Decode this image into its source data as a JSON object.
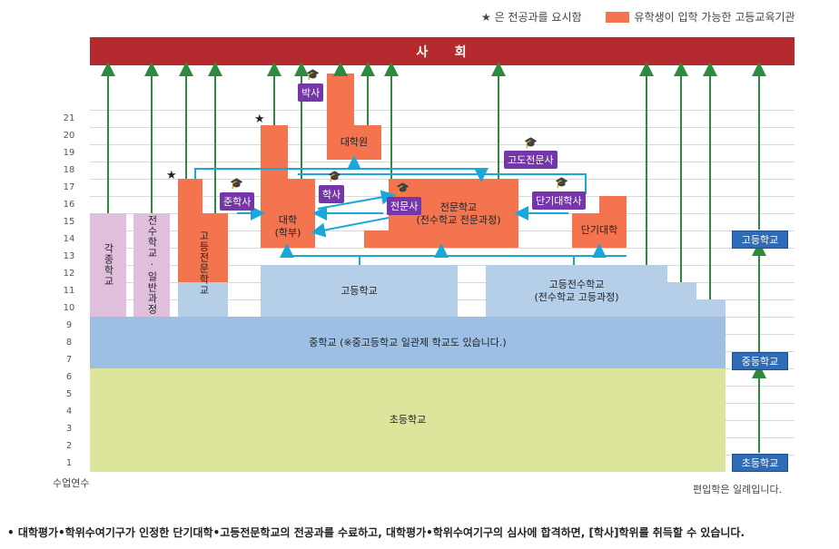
{
  "legend": {
    "star_text": "★ 은 전공과를 요시함",
    "box_text": "유학생이 입학 가능한 고등교육기관"
  },
  "header": {
    "title": "사    회"
  },
  "years_axis": {
    "labels": [
      "1",
      "2",
      "3",
      "4",
      "5",
      "6",
      "7",
      "8",
      "9",
      "10",
      "11",
      "12",
      "13",
      "14",
      "15",
      "16",
      "17",
      "18",
      "19",
      "20",
      "21"
    ],
    "footer": "수업연수"
  },
  "blocks": {
    "elementary": "초등학교",
    "middle": "중학교 (※중고등학교 일관제 학교도 있습니다.)",
    "high_school": "고등학교",
    "high_vocational": "고등전수학교\n(전수학교 고등과정)",
    "misc_school": "각종학교",
    "vocational_general": "전수학교·일반과정",
    "tech_college": "고등전문학교",
    "university": "대학\n(학부)",
    "graduate": "대학원",
    "specialized": "전문학교\n(전수학교 전문과정)",
    "junior_college": "단기대학"
  },
  "degrees": {
    "doctor": "박사",
    "bachelor": "학사",
    "associate": "준학사",
    "professional": "전문사",
    "advanced_professional": "고도전문사",
    "junior_college_degree": "단기대학사"
  },
  "side_labels": {
    "high": "고등학교",
    "middle": "중등학교",
    "elementary": "초등학교"
  },
  "notes": {
    "transfer": "편입학은 일례입니다.",
    "footnote": "• 대학평가•학위수여기구가 인정한 단기대학•고등전문학교의 전공과를 수료하고, 대학평가•학위수여기구의 심사에 합격하면, [학사]학위를 취득할 수 있습니다."
  },
  "colors": {
    "header": "#b42a2e",
    "higher_edu": "#f4744f",
    "degree": "#7436a8",
    "arrow_green": "#2e8b3e",
    "arrow_cyan": "#1aa7d9",
    "elementary": "#dde49c",
    "secondary": "#9dbfe3"
  }
}
